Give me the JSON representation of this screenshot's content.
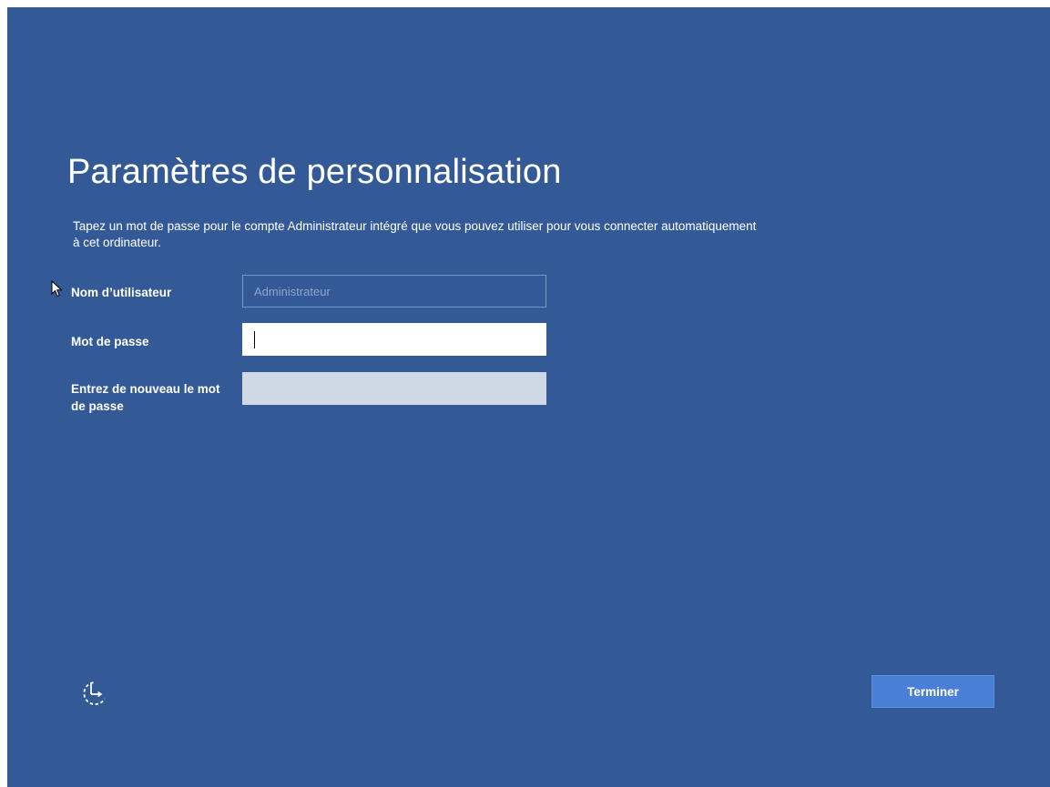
{
  "screen": {
    "title": "Paramètres de personnalisation",
    "description": "Tapez un mot de passe pour le compte Administrateur intégré que vous pouvez utiliser pour vous connecter automatiquement à cet ordinateur."
  },
  "form": {
    "username": {
      "label": "Nom d’utilisateur",
      "placeholder": "Administrateur",
      "value": ""
    },
    "password": {
      "label": "Mot de passe",
      "value": ""
    },
    "confirm_password": {
      "label": "Entrez de nouveau le mot de passe",
      "value": ""
    }
  },
  "footer": {
    "accessibility_icon": "ease-of-access-icon",
    "finish_label": "Terminer"
  },
  "colors": {
    "background": "#335a97",
    "button": "#4a7fd8",
    "disabled_field": "#cfd9e6"
  }
}
